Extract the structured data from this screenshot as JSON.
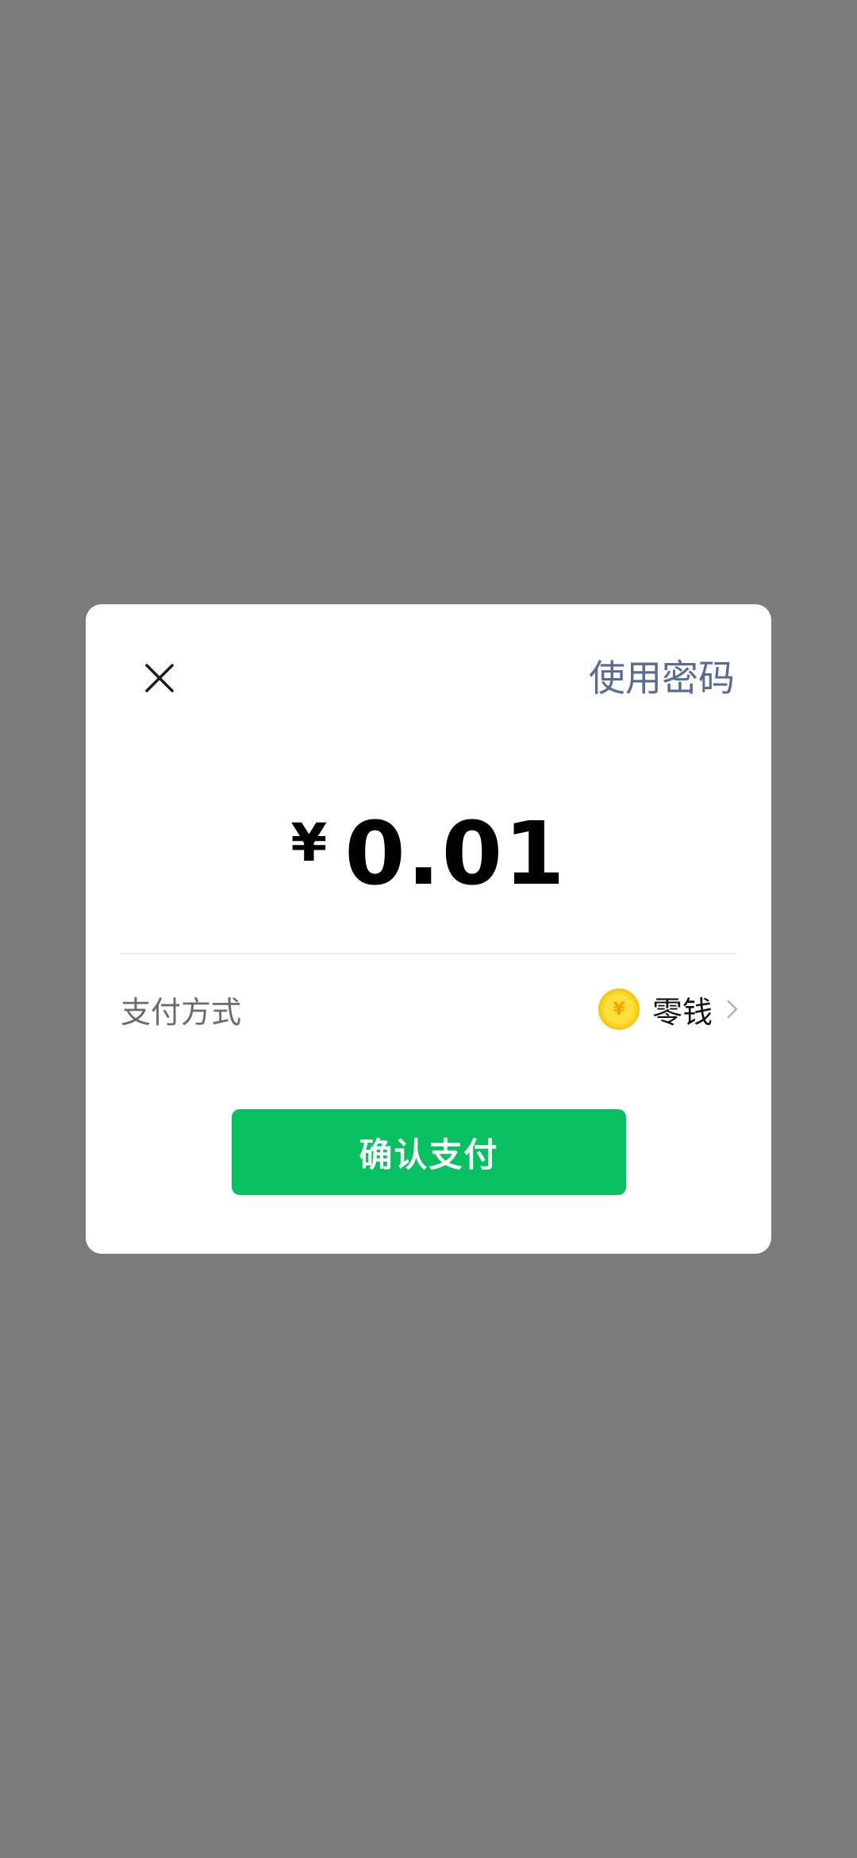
{
  "overlay": {
    "background_color": "#7b7b7b"
  },
  "dialog": {
    "close_icon": "close-icon",
    "use_password_label": "使用密码",
    "amount": {
      "currency_symbol": "¥",
      "value": "0.01"
    },
    "payment": {
      "label": "支付方式",
      "method_icon": "coin-icon",
      "method_icon_glyph": "¥",
      "method_name": "零钱",
      "chevron_icon": "chevron-right-icon"
    },
    "confirm_label": "确认支付"
  },
  "colors": {
    "link": "#576b95",
    "primary_button": "#07c160",
    "coin": "#fbd524"
  }
}
